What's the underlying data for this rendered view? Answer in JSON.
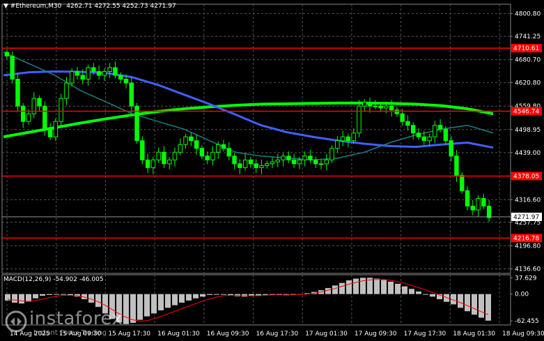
{
  "header": {
    "symbol": "#Ethereum,M30",
    "ohlc": "4262.71 4272.55 4252.73 4271.97"
  },
  "macd": {
    "label": "MACD(12,26,9) -54.902 -46.005"
  },
  "watermark": {
    "brand": "instaforex",
    "tagline": "Instant Forex Trading"
  },
  "chart_data": {
    "type": "candlestick",
    "price_axis": {
      "ticks": [
        "4800.80",
        "4741.25",
        "4680.70",
        "4620.80",
        "4559.80",
        "4498.95",
        "4439.00",
        "4316.60",
        "4257.75",
        "4196.80",
        "4136.60"
      ],
      "range": [
        4125,
        4825
      ]
    },
    "time_axis": {
      "ticks": [
        "14 Aug 2025",
        "15 Aug 09:30",
        "15 Aug 17:30",
        "16 Aug 01:30",
        "16 Aug 09:30",
        "16 Aug 17:30",
        "17 Aug 01:30",
        "17 Aug 09:30",
        "17 Aug 17:30",
        "18 Aug 01:30",
        "18 Aug 09:30"
      ]
    },
    "levels": [
      {
        "label": "4710.61",
        "value": 4710.61,
        "color": "#ff0000"
      },
      {
        "label": "4546.74",
        "value": 4546.74,
        "color": "#ff0000"
      },
      {
        "label": "4378.05",
        "value": 4378.05,
        "color": "#ff0000"
      },
      {
        "label": "4216.78",
        "value": 4216.78,
        "color": "#ff0000"
      }
    ],
    "current_price": {
      "label": "4271.97",
      "value": 4271.97
    },
    "close": [
      4690,
      4630,
      4560,
      4520,
      4540,
      4580,
      4560,
      4500,
      4480,
      4520,
      4580,
      4620,
      4650,
      4640,
      4630,
      4660,
      4650,
      4640,
      4650,
      4660,
      4640,
      4630,
      4620,
      4560,
      4470,
      4420,
      4400,
      4420,
      4440,
      4410,
      4420,
      4440,
      4460,
      4480,
      4470,
      4450,
      4430,
      4420,
      4440,
      4460,
      4450,
      4430,
      4410,
      4400,
      4420,
      4410,
      4400,
      4405,
      4410,
      4415,
      4420,
      4430,
      4420,
      4410,
      4420,
      4430,
      4420,
      4410,
      4410,
      4420,
      4450,
      4470,
      4480,
      4470,
      4490,
      4560,
      4570,
      4560,
      4560,
      4555,
      4560,
      4550,
      4540,
      4520,
      4510,
      4490,
      4480,
      4470,
      4480,
      4510,
      4500,
      4470,
      4430,
      4380,
      4340,
      4300,
      4290,
      4320,
      4300,
      4270
    ],
    "series": [
      {
        "name": "",
        "color": "#00ff00",
        "values": [
          4480,
          4492,
          4504,
          4516,
          4527,
          4537,
          4546,
          4553,
          4558,
          4562,
          4565,
          4566,
          4567,
          4568,
          4568,
          4567,
          4565,
          4561,
          4553,
          4540
        ]
      },
      {
        "name": "",
        "color": "#4060ff",
        "values": [
          4640,
          4648,
          4650,
          4649,
          4646,
          4635,
          4615,
          4590,
          4565,
          4538,
          4510,
          4492,
          4480,
          4470,
          4462,
          4456,
          4454,
          4460,
          4465,
          4452
        ]
      },
      {
        "name": "",
        "color": "#1a8080",
        "values": [
          4700,
          4670,
          4640,
          4600,
          4570,
          4540,
          4520,
          4500,
          4470,
          4440,
          4430,
          4425,
          4420,
          4425,
          4440,
          4465,
          4485,
          4500,
          4510,
          4490
        ]
      }
    ],
    "macd_axis": {
      "ticks": [
        "37.629",
        "0.00",
        "-62.455"
      ],
      "range": [
        -72,
        45
      ]
    },
    "macd_hist": [
      -15,
      -20,
      -22,
      -18,
      -10,
      -4,
      -2,
      0,
      -1,
      -3,
      -6,
      -12,
      -20,
      -30,
      -45,
      -58,
      -66,
      -70,
      -67,
      -60,
      -52,
      -45,
      -38,
      -32,
      -26,
      -20,
      -15,
      -10,
      -6,
      -2,
      0,
      -1,
      -3,
      -5,
      -6,
      -4,
      -3,
      -2,
      -1,
      -2,
      -3,
      -1,
      0,
      2,
      5,
      9,
      14,
      20,
      26,
      32,
      36,
      38,
      38,
      36,
      33,
      29,
      24,
      18,
      12,
      6,
      0,
      -6,
      -12,
      -18,
      -24,
      -32,
      -40,
      -48,
      -55,
      -62
    ],
    "macd_signal": [
      -12,
      -14,
      -16,
      -17,
      -15,
      -12,
      -8,
      -5,
      -3,
      -3,
      -4,
      -7,
      -12,
      -18,
      -26,
      -36,
      -46,
      -54,
      -60,
      -63,
      -62,
      -58,
      -52,
      -46,
      -40,
      -34,
      -28,
      -22,
      -16,
      -11,
      -7,
      -4,
      -3,
      -3,
      -4,
      -4,
      -4,
      -3,
      -2,
      -2,
      -2,
      -2,
      -1,
      0,
      2,
      5,
      9,
      13,
      18,
      23,
      27,
      31,
      33,
      34,
      34,
      32,
      29,
      25,
      20,
      15,
      10,
      4,
      -2,
      -8,
      -14,
      -20,
      -27,
      -34,
      -41,
      -48
    ]
  }
}
